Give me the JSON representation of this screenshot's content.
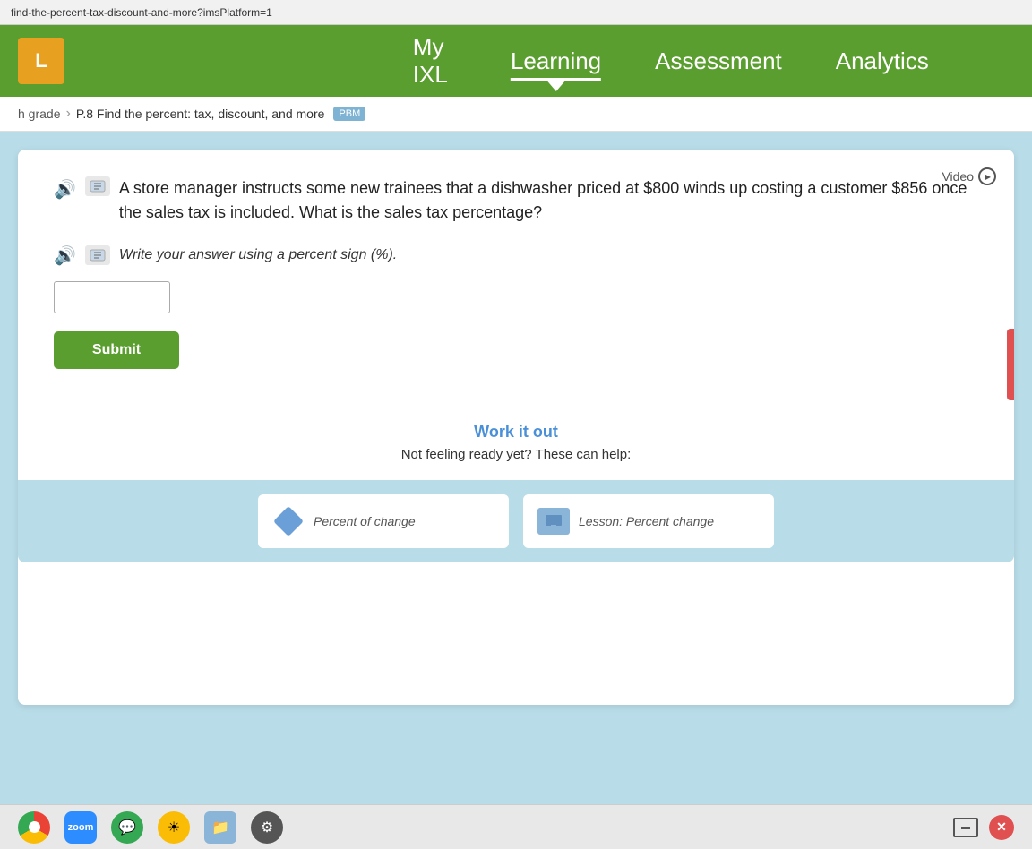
{
  "urlbar": {
    "text": "find-the-percent-tax-discount-and-more?imsPlatform=1"
  },
  "breadcrumb": {
    "grade": "h grade",
    "separator": "›",
    "lesson": "P.8 Find the percent: tax, discount, and more",
    "badge": "PBM"
  },
  "nav": {
    "logo": "L",
    "links": [
      {
        "label": "My IXL",
        "active": false
      },
      {
        "label": "Learning",
        "active": true
      },
      {
        "label": "Assessment",
        "active": false
      },
      {
        "label": "Analytics",
        "active": false
      }
    ]
  },
  "question": {
    "text": "A store manager instructs some new trainees that a dishwasher priced at $800 winds up costing a customer $856 once the sales tax is included. What is the sales tax percentage?",
    "instruction": "Write your answer using a percent sign (%).",
    "answer_placeholder": "",
    "submit_label": "Submit"
  },
  "video": {
    "label": "Video"
  },
  "work_it_out": {
    "title": "Work it out",
    "subtitle": "Not feeling ready yet? These can help:"
  },
  "resources": [
    {
      "type": "diamond",
      "label": "Percent of change"
    },
    {
      "type": "screen",
      "label": "Lesson: Percent change"
    }
  ]
}
